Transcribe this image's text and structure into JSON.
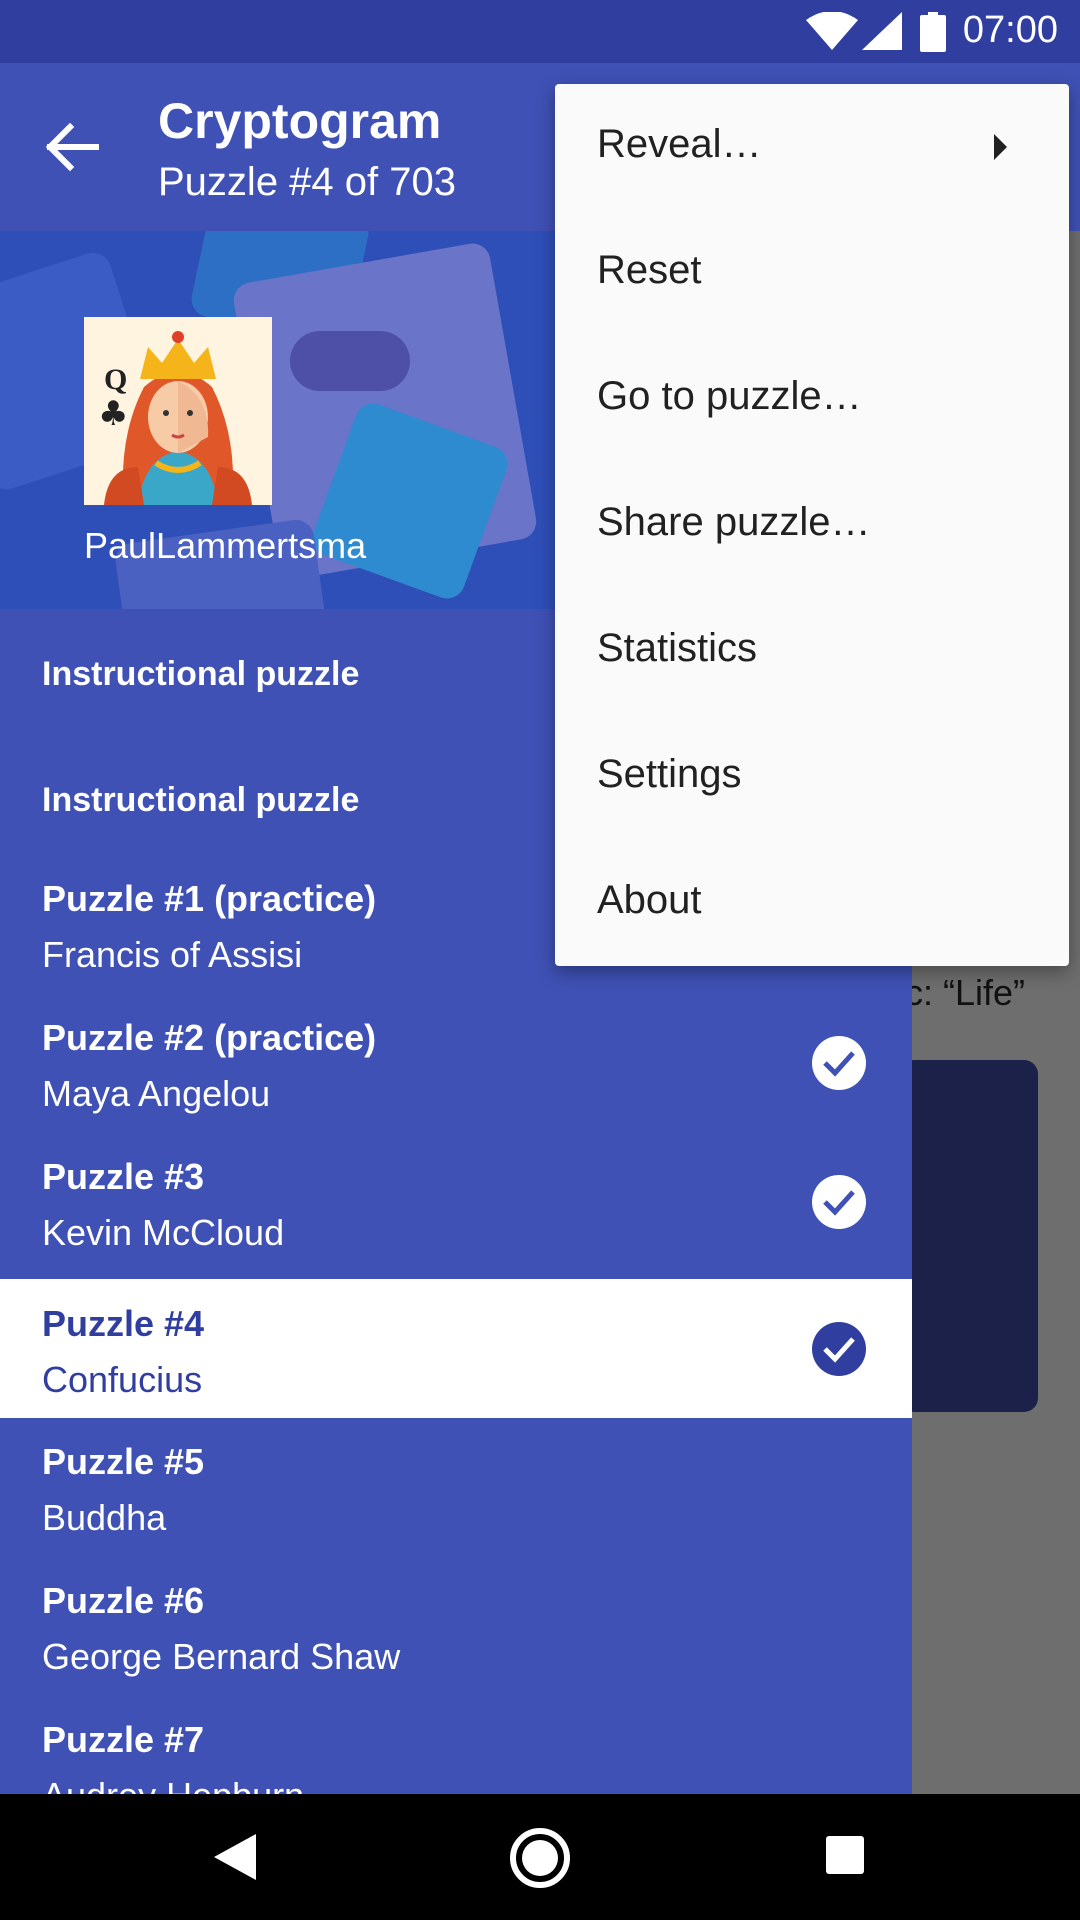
{
  "status_bar": {
    "time": "07:00",
    "icons": [
      "wifi-icon",
      "signal-icon",
      "battery-icon"
    ]
  },
  "toolbar": {
    "back_icon": "arrow-left-icon",
    "title": "Cryptogram",
    "subtitle": "Puzzle #4 of 703"
  },
  "background": {
    "topic_text": "c: “Life”"
  },
  "drawer": {
    "username": "PaulLammertsma",
    "sections": [
      {
        "label": "Instructional puzzle"
      },
      {
        "label": "Instructional puzzle"
      }
    ],
    "items": [
      {
        "title": "Puzzle #1 (practice)",
        "author": "Francis of Assisi",
        "completed": false,
        "selected": false
      },
      {
        "title": "Puzzle #2 (practice)",
        "author": "Maya Angelou",
        "completed": true,
        "selected": false
      },
      {
        "title": "Puzzle #3",
        "author": "Kevin McCloud",
        "completed": true,
        "selected": false
      },
      {
        "title": "Puzzle #4",
        "author": "Confucius",
        "completed": true,
        "selected": true
      },
      {
        "title": "Puzzle #5",
        "author": "Buddha",
        "completed": false,
        "selected": false
      },
      {
        "title": "Puzzle #6",
        "author": "George Bernard Shaw",
        "completed": false,
        "selected": false
      },
      {
        "title": "Puzzle #7",
        "author": "Audrey Hepburn",
        "completed": false,
        "selected": false
      }
    ]
  },
  "menu": {
    "items": [
      {
        "label": "Reveal…",
        "has_submenu": true
      },
      {
        "label": "Reset"
      },
      {
        "label": "Go to puzzle…"
      },
      {
        "label": "Share puzzle…"
      },
      {
        "label": "Statistics"
      },
      {
        "label": "Settings"
      },
      {
        "label": "About"
      }
    ]
  },
  "nav_bar": {
    "icons": [
      "back-triangle-icon",
      "home-circle-icon",
      "recents-square-icon"
    ]
  },
  "colors": {
    "primary": "#3f51b5",
    "primary_dark": "#303f9f",
    "menu_bg": "#fafafa",
    "scrim": "#6e6e6e"
  }
}
